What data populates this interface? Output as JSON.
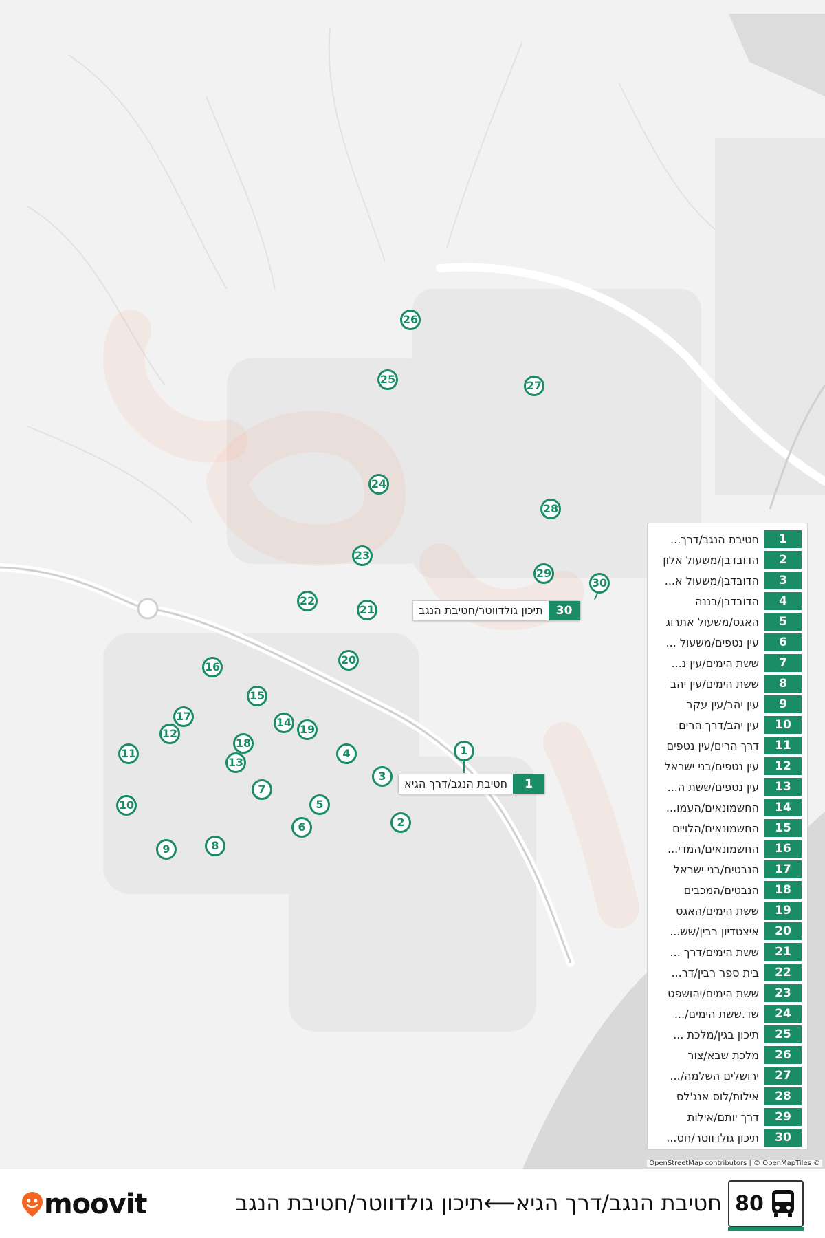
{
  "route": {
    "number": "80",
    "title": "חטיבת הנגב/דרך הגיא⟵תיכון גולדווטר/חטיבת הנגב",
    "icon": "bus-icon"
  },
  "brand": {
    "name": "moovit",
    "logo_color": "#f26522"
  },
  "colors": {
    "accent": "#1a8c66",
    "route_line": "#ff9a7a",
    "map_bg": "#f2f2f2"
  },
  "attribution": "OpenStreetMap contributors | © OpenMapTiles ©",
  "callouts": {
    "first": {
      "number": "1",
      "name": "חטיבת הנגב/דרך הגיא"
    },
    "last": {
      "number": "30",
      "name": "תיכון גולדווטר/חטיבת הנגב"
    }
  },
  "stops": [
    {
      "number": "1",
      "name": "חטיבת הנגב/דרך..."
    },
    {
      "number": "2",
      "name": "הדובדבן/משעול אלון"
    },
    {
      "number": "3",
      "name": "הדובדבן/משעול א..."
    },
    {
      "number": "4",
      "name": "הדובדבן/בננה"
    },
    {
      "number": "5",
      "name": "האגס/משעול אתרוג"
    },
    {
      "number": "6",
      "name": "עין נטפים/משעול ..."
    },
    {
      "number": "7",
      "name": "ששת הימים/עין נ..."
    },
    {
      "number": "8",
      "name": "ששת הימים/עין יהב"
    },
    {
      "number": "9",
      "name": "עין יהב/עין עקב"
    },
    {
      "number": "10",
      "name": "עין יהב/דרך הרים"
    },
    {
      "number": "11",
      "name": "דרך הרים/עין נטפים"
    },
    {
      "number": "12",
      "name": "עין נטפים/בני ישראל"
    },
    {
      "number": "13",
      "name": "עין נטפים/ששת ה..."
    },
    {
      "number": "14",
      "name": "החשמונאים/העמו..."
    },
    {
      "number": "15",
      "name": "החשמונאים/הלויים"
    },
    {
      "number": "16",
      "name": "החשמונאים/המדי..."
    },
    {
      "number": "17",
      "name": "הנבטים/בני ישראל"
    },
    {
      "number": "18",
      "name": "הנבטים/המכבים"
    },
    {
      "number": "19",
      "name": "ששת הימים/האגס"
    },
    {
      "number": "20",
      "name": "איצטדיון רבין/שש..."
    },
    {
      "number": "21",
      "name": "ששת הימים/דרך ..."
    },
    {
      "number": "22",
      "name": "בית ספר רבין/דר..."
    },
    {
      "number": "23",
      "name": "ששת הימים/יהושפט"
    },
    {
      "number": "24",
      "name": "שד.ששת הימים/..."
    },
    {
      "number": "25",
      "name": "תיכון בגין/מלכת ..."
    },
    {
      "number": "26",
      "name": "מלכת שבא/צור"
    },
    {
      "number": "27",
      "name": "ירושלים השלמה/..."
    },
    {
      "number": "28",
      "name": "אילות/לוס אנג'לס"
    },
    {
      "number": "29",
      "name": "דרך יותם/אילות"
    },
    {
      "number": "30",
      "name": "תיכון גולדווטר/חט..."
    }
  ]
}
